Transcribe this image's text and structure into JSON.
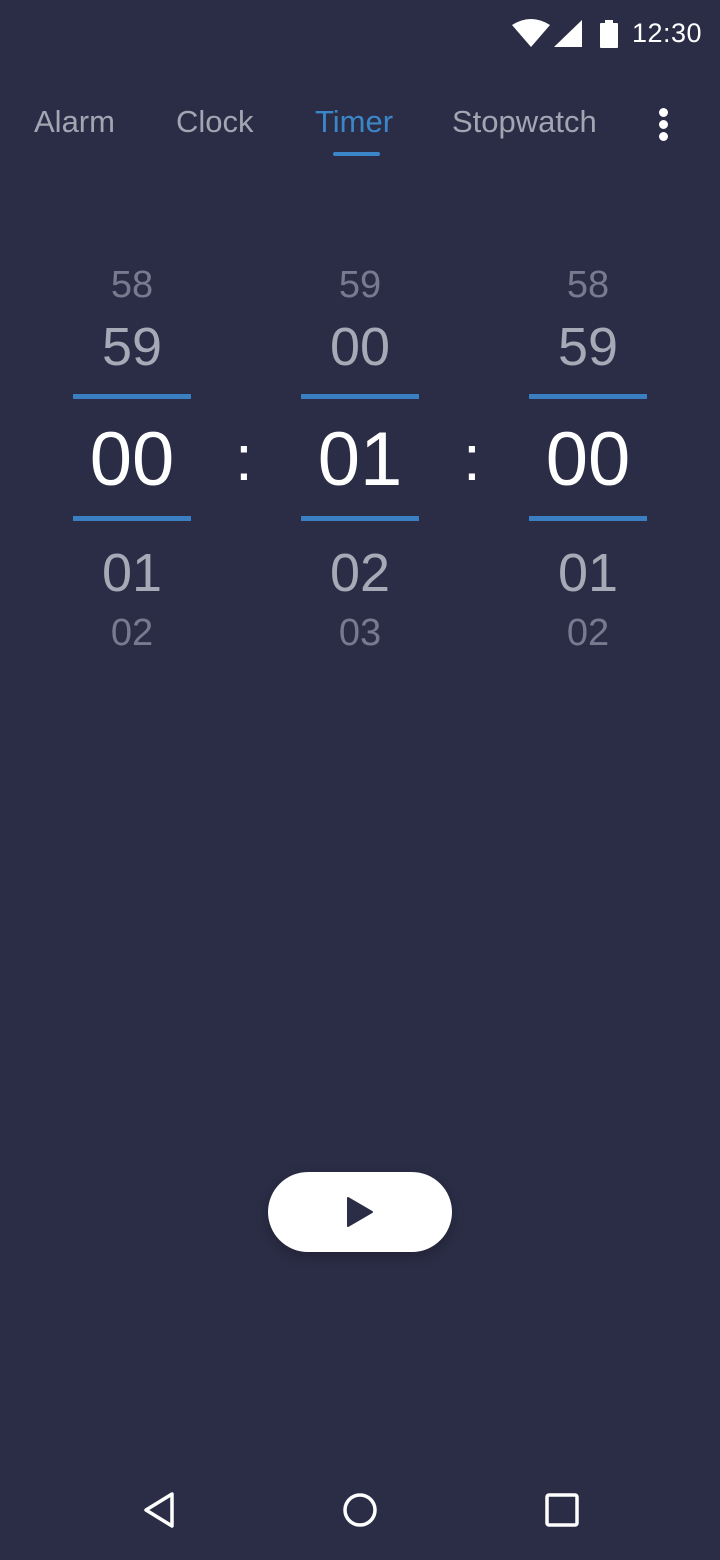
{
  "status_bar": {
    "time": "12:30",
    "icons": [
      "wifi-icon",
      "cell-signal-icon",
      "battery-icon"
    ]
  },
  "tabs": [
    {
      "label": "Alarm",
      "active": false
    },
    {
      "label": "Clock",
      "active": false
    },
    {
      "label": "Timer",
      "active": true
    },
    {
      "label": "Stopwatch",
      "active": false
    }
  ],
  "more_menu_icon": "more-vert-icon",
  "timer_picker": {
    "separator": ":",
    "hours": {
      "prev2": "58",
      "prev1": "59",
      "selected": "00",
      "next1": "01",
      "next2": "02"
    },
    "minutes": {
      "prev2": "59",
      "prev1": "00",
      "selected": "01",
      "next1": "02",
      "next2": "03"
    },
    "seconds": {
      "prev2": "58",
      "prev1": "59",
      "selected": "00",
      "next1": "01",
      "next2": "02"
    }
  },
  "start_button": {
    "icon": "play-icon"
  },
  "nav_bar": {
    "icons": [
      "back-icon",
      "home-icon",
      "recents-icon"
    ]
  },
  "colors": {
    "background": "#2b2d46",
    "accent": "#3b86c8",
    "tab_inactive": "#a3a5b2",
    "selected_number": "#ffffff"
  }
}
